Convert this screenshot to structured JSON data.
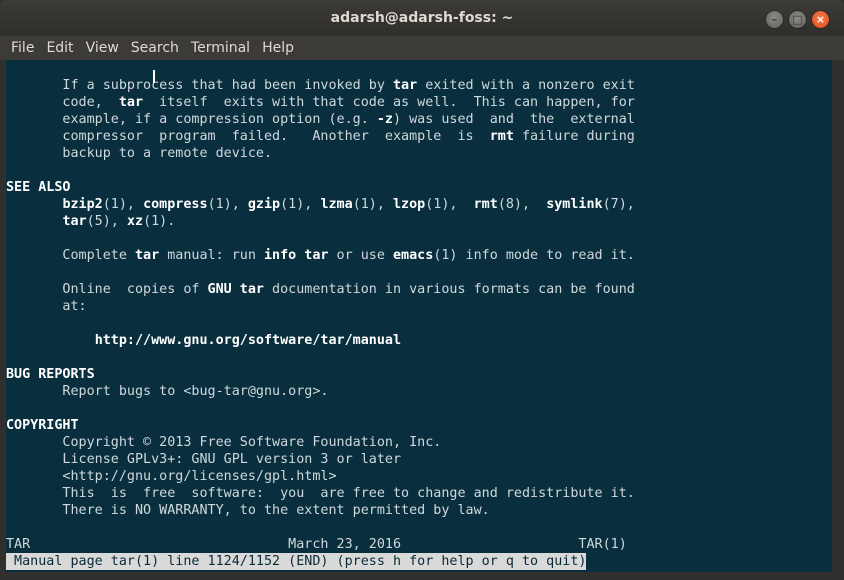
{
  "window": {
    "title": "adarsh@adarsh-foss: ~",
    "buttons": [
      "minimize",
      "maximize",
      "close"
    ]
  },
  "menu": [
    "File",
    "Edit",
    "View",
    "Search",
    "Terminal",
    "Help"
  ],
  "terminal": {
    "lines": [
      [
        {
          "t": "       If a subprocess that had been invoked by "
        },
        {
          "t": "tar",
          "b": true
        },
        {
          "t": " exited with a nonzero exit"
        }
      ],
      [
        {
          "t": "       code,  "
        },
        {
          "t": "tar",
          "b": true
        },
        {
          "t": "  itself  exits with that code as well.  This can happen, for"
        }
      ],
      [
        {
          "t": "       example, if a compression option (e.g. "
        },
        {
          "t": "-z",
          "b": true
        },
        {
          "t": ") was used  and  the  external"
        }
      ],
      [
        {
          "t": "       compressor  program  failed.   Another  example  is  "
        },
        {
          "t": "rmt",
          "b": true
        },
        {
          "t": " failure during"
        }
      ],
      [
        {
          "t": "       backup to a remote device."
        }
      ],
      [],
      [
        {
          "t": "SEE ALSO",
          "b": true
        }
      ],
      [
        {
          "t": "       "
        },
        {
          "t": "bzip2",
          "b": true
        },
        {
          "t": "(1), "
        },
        {
          "t": "compress",
          "b": true
        },
        {
          "t": "(1), "
        },
        {
          "t": "gzip",
          "b": true
        },
        {
          "t": "(1), "
        },
        {
          "t": "lzma",
          "b": true
        },
        {
          "t": "(1), "
        },
        {
          "t": "lzop",
          "b": true
        },
        {
          "t": "(1),  "
        },
        {
          "t": "rmt",
          "b": true
        },
        {
          "t": "(8),  "
        },
        {
          "t": "symlink",
          "b": true
        },
        {
          "t": "(7),"
        }
      ],
      [
        {
          "t": "       "
        },
        {
          "t": "tar",
          "b": true
        },
        {
          "t": "(5), "
        },
        {
          "t": "xz",
          "b": true
        },
        {
          "t": "(1)."
        }
      ],
      [],
      [
        {
          "t": "       Complete "
        },
        {
          "t": "tar",
          "b": true
        },
        {
          "t": " manual: run "
        },
        {
          "t": "info tar",
          "b": true
        },
        {
          "t": " or use "
        },
        {
          "t": "emacs",
          "b": true
        },
        {
          "t": "(1) info mode to read it."
        }
      ],
      [],
      [
        {
          "t": "       Online  copies of "
        },
        {
          "t": "GNU tar",
          "b": true
        },
        {
          "t": " documentation in various formats can be found"
        }
      ],
      [
        {
          "t": "       at:"
        }
      ],
      [],
      [
        {
          "t": "           "
        },
        {
          "t": "http://www.gnu.org/software/tar/manual",
          "b": true
        }
      ],
      [],
      [
        {
          "t": "BUG REPORTS",
          "b": true
        }
      ],
      [
        {
          "t": "       Report bugs to <bug-tar@gnu.org>."
        }
      ],
      [],
      [
        {
          "t": "COPYRIGHT",
          "b": true
        }
      ],
      [
        {
          "t": "       Copyright © 2013 Free Software Foundation, Inc."
        }
      ],
      [
        {
          "t": "       License GPLv3+: GNU GPL version 3 or later"
        }
      ],
      [
        {
          "t": "       <http://gnu.org/licenses/gpl.html>"
        }
      ],
      [
        {
          "t": "       This  is  free  software:  you  are free to change and redistribute it."
        }
      ],
      [
        {
          "t": "       There is NO WARRANTY, to the extent permitted by law."
        }
      ],
      [],
      [
        {
          "t": "TAR                                March 23, 2016                      TAR(1)"
        }
      ]
    ],
    "status": " Manual page tar(1) line 1124/1152 (END) (press h for help or q to quit)"
  },
  "colors": {
    "terminal_bg": "#092f3e",
    "text": "#cfd8dc",
    "bold_text": "#ffffff",
    "close_button": "#e0491c"
  }
}
